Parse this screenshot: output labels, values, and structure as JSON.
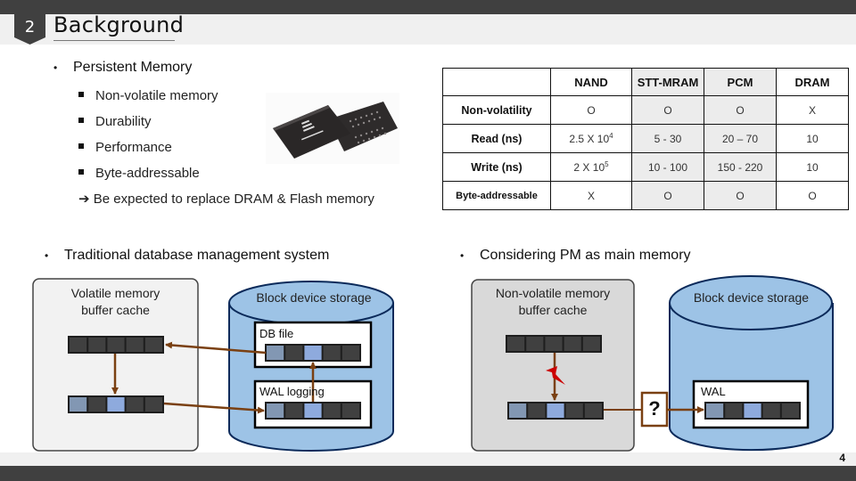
{
  "header": {
    "section_number": "2",
    "title": "Background"
  },
  "persistent_memory": {
    "heading": "Persistent Memory",
    "items": [
      "Non-volatile memory",
      "Durability",
      "Performance",
      "Byte-addressable"
    ],
    "conclusion": "Be expected to replace DRAM & Flash memory",
    "image": "pcm-chip-image"
  },
  "comparison_table": {
    "columns": [
      "",
      "NAND",
      "STT-MRAM",
      "PCM",
      "DRAM"
    ],
    "highlight_columns": [
      "STT-MRAM",
      "PCM"
    ],
    "header_highlight_color": "#1a1a8c",
    "rows": [
      {
        "label": "Non-volatility",
        "values": [
          "O",
          "O",
          "O",
          "X"
        ]
      },
      {
        "label": "Read (ns)",
        "values": [
          "2.5 X 10",
          "5 - 30",
          "20 – 70",
          "10"
        ],
        "nand_exponent": "4"
      },
      {
        "label": "Write (ns)",
        "values": [
          "2 X 10",
          "10 - 100",
          "150 - 220",
          "10"
        ],
        "nand_exponent": "5"
      },
      {
        "label": "Byte-addressable",
        "values": [
          "X",
          "O",
          "O",
          "O"
        ]
      }
    ]
  },
  "left_diagram": {
    "heading": "Traditional database management system",
    "buffer_label": "Volatile memory buffer cache",
    "buffer_label_line1": "Volatile memory",
    "buffer_label_line2": "buffer cache",
    "storage_label": "Block device storage",
    "db_file_label": "DB file",
    "wal_label": "WAL logging"
  },
  "right_diagram": {
    "heading": "Considering PM as main memory",
    "buffer_label_line1": "Non-volatile memory",
    "buffer_label_line2": "buffer cache",
    "storage_label": "Block device storage",
    "wal_label": "WAL",
    "question_mark": "?"
  },
  "colors": {
    "cell_dark": "#404040",
    "cell_gray_blue": "#8297b3",
    "cell_light_blue": "#8eaadd",
    "cylinder_fill": "#9dc3e6",
    "cylinder_stroke": "#0b2a5a",
    "arrow": "#7a4012",
    "bolt": "#cc0000"
  },
  "footer": {
    "page_number": "4"
  }
}
